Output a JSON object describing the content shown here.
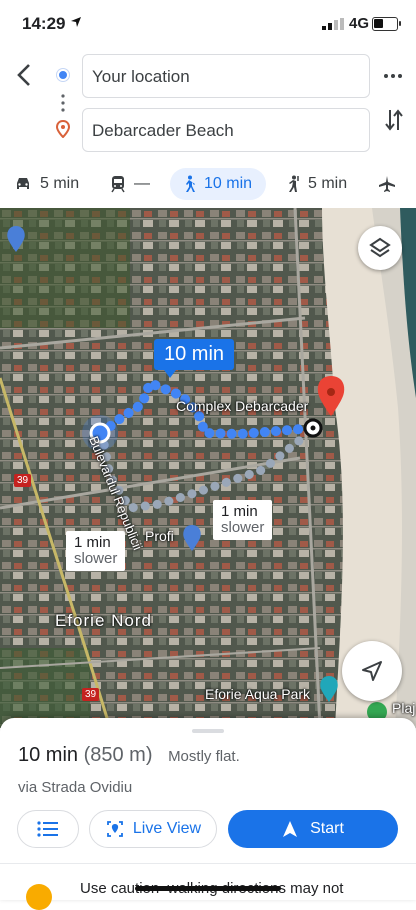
{
  "status": {
    "time": "14:29",
    "network": "4G"
  },
  "search": {
    "origin": "Your location",
    "destination": "Debarcader Beach"
  },
  "modes": [
    {
      "id": "drive",
      "label": "5 min"
    },
    {
      "id": "transit",
      "label": "—"
    },
    {
      "id": "walk",
      "label": "10 min",
      "active": true
    },
    {
      "id": "ride",
      "label": "5 min"
    },
    {
      "id": "flight",
      "label": ""
    }
  ],
  "map": {
    "eta_bubble": "10 min",
    "alt_routes": [
      {
        "time": "1 min",
        "note": "slower"
      },
      {
        "time": "1 min",
        "note": "slower"
      }
    ],
    "labels": {
      "street": "Bulevardul Republicii",
      "place": "Complex Debarcader",
      "shop": "Profi",
      "town": "Eforie Nord",
      "park": "Eforie Aqua Park",
      "beach_partial": "Plaj",
      "road_badge_1": "39",
      "road_badge_2": "39"
    }
  },
  "sheet": {
    "duration": "10 min",
    "distance": "(850 m)",
    "terrain": "Mostly flat.",
    "via": "via Strada Ovidiu",
    "live_view": "Live View",
    "start": "Start",
    "warning": "Use caution–walking directions may not"
  },
  "colors": {
    "accent": "#1a73e8",
    "route": "#4285f4",
    "alt_route": "#9aa7b8",
    "pin": "#ea4335"
  }
}
